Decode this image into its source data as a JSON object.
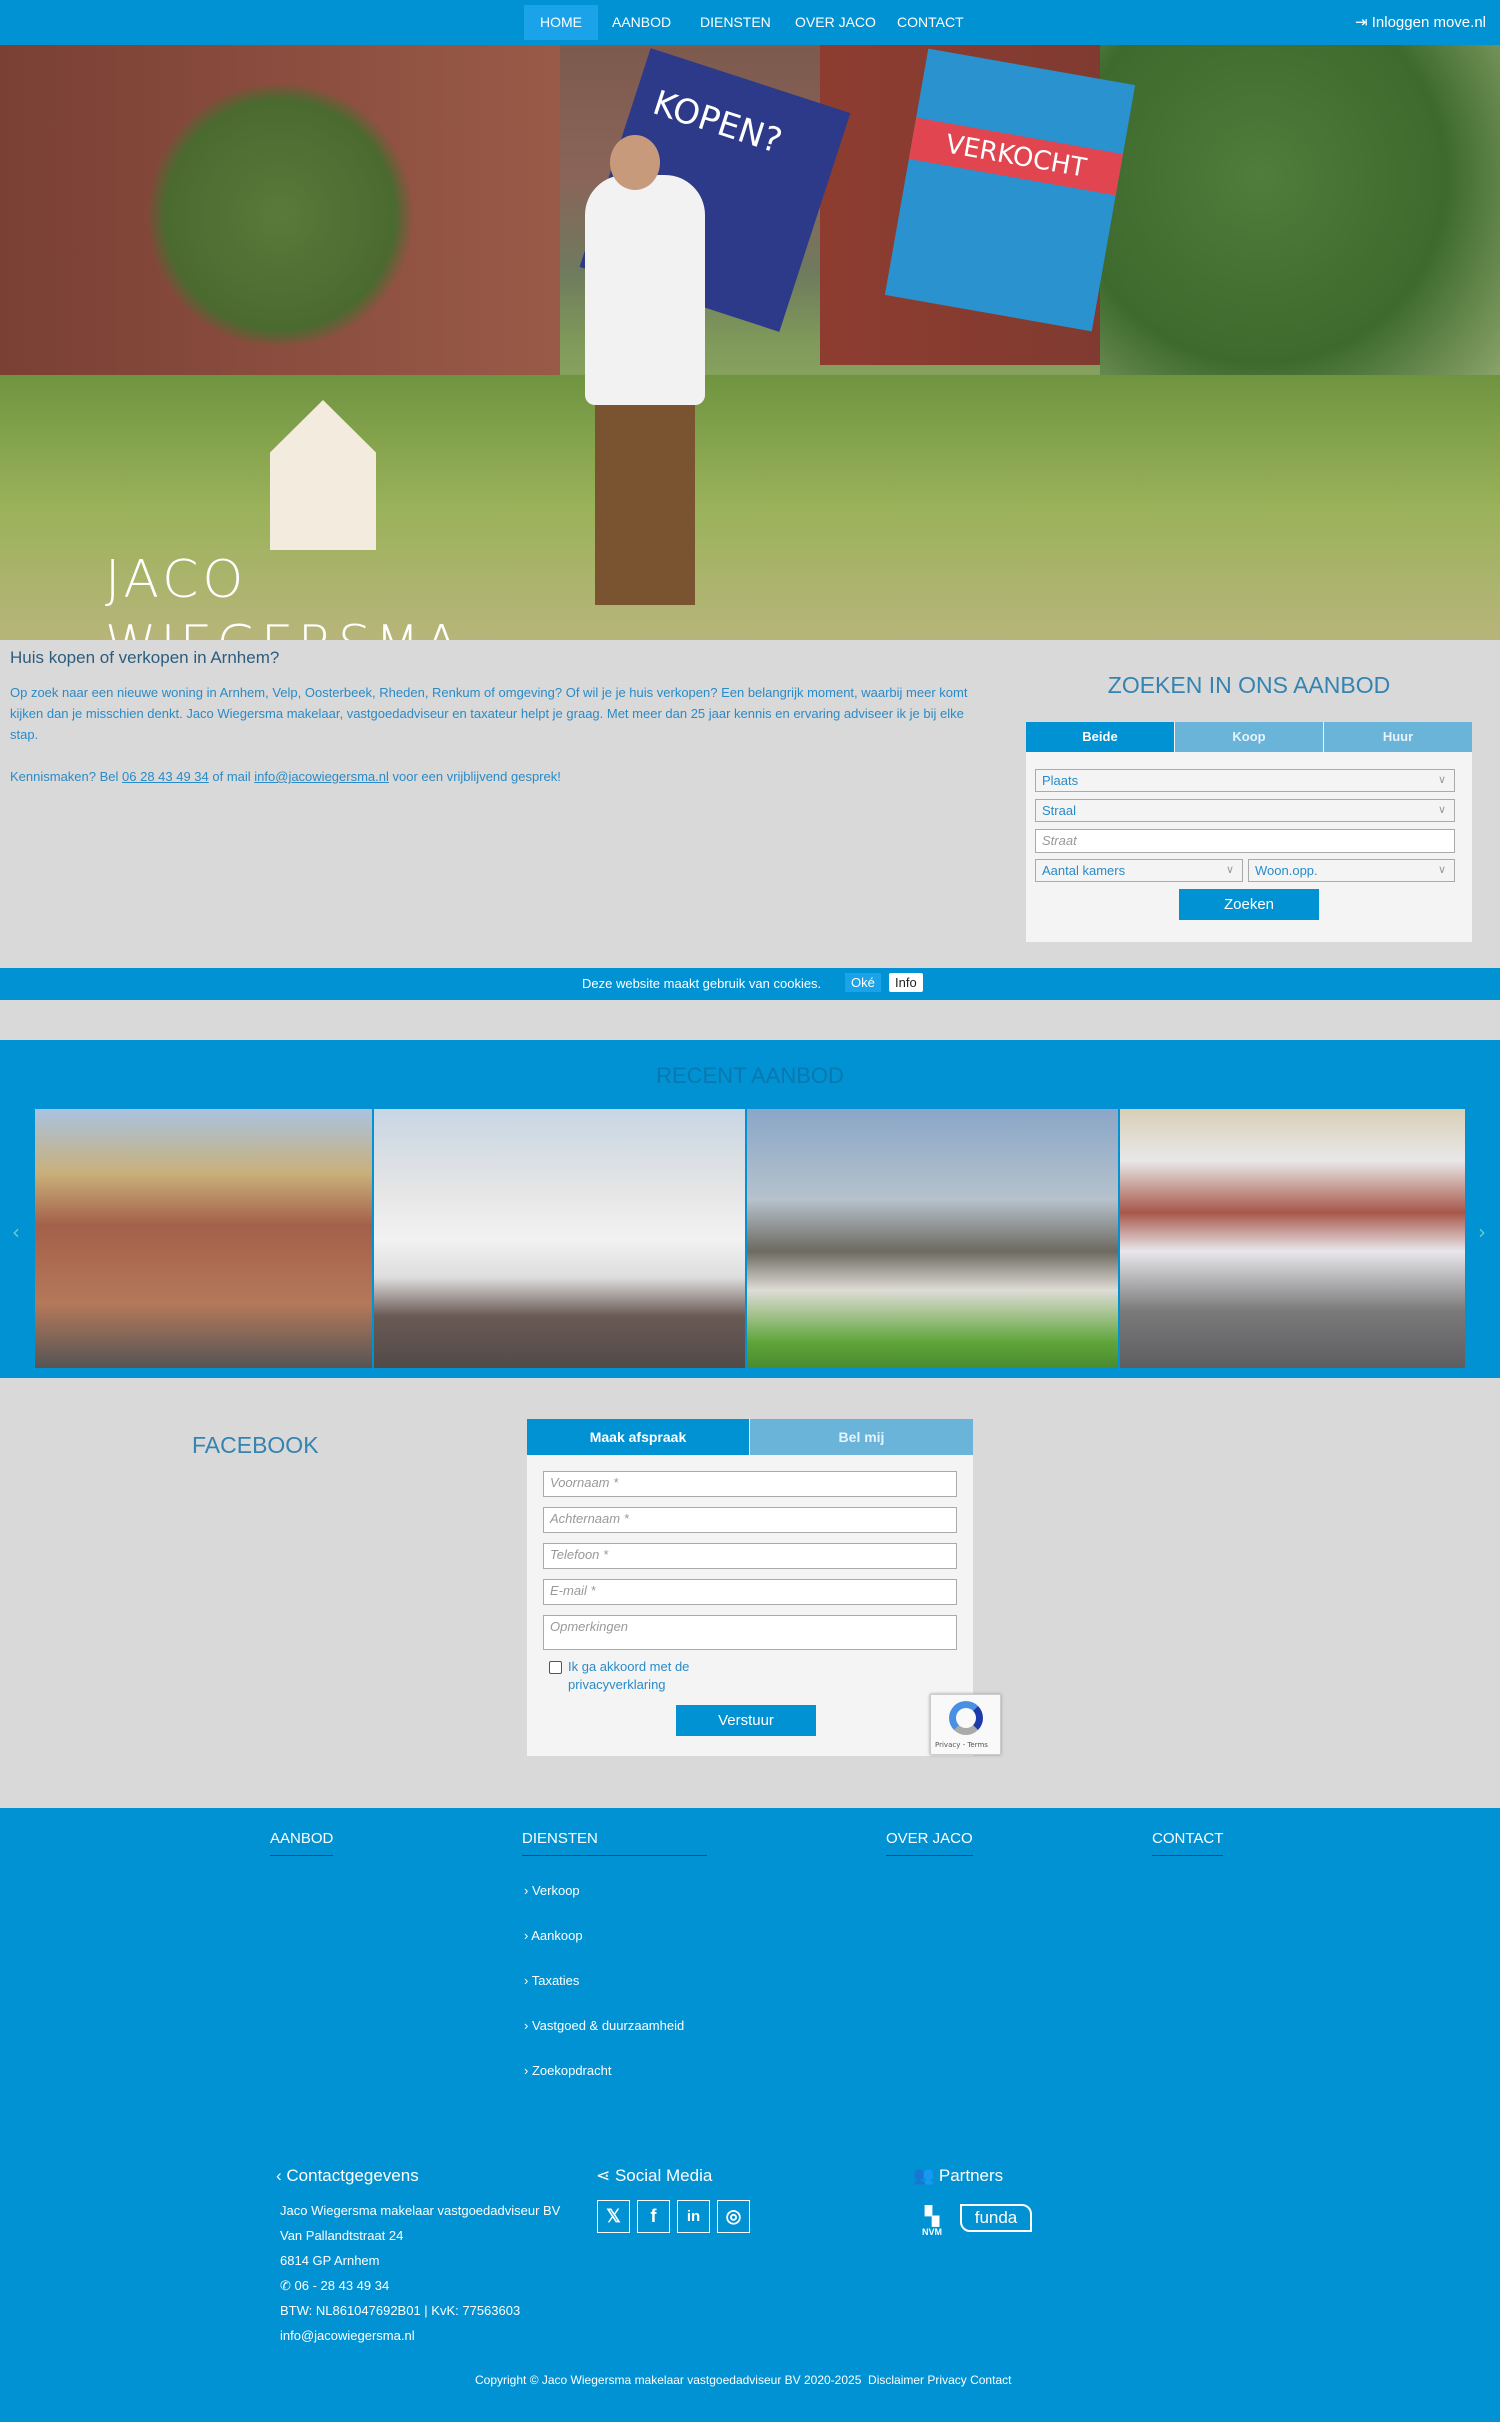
{
  "nav": {
    "items": [
      "HOME",
      "AANBOD",
      "DIENSTEN",
      "OVER JACO",
      "CONTACT"
    ],
    "active": "HOME",
    "login": "Inloggen move.nl"
  },
  "hero": {
    "logo_text": [
      "JACO",
      "WIEGERSMA"
    ],
    "sign_left": "KOPEN?",
    "sign_right": "VERKOCHT"
  },
  "intro": {
    "title": "Huis kopen of verkopen in Arnhem?",
    "paragraph": "Op zoek naar een nieuwe woning in Arnhem, Velp, Oosterbeek, Rheden, Renkum of omgeving? Of wil je je huis verkopen? Een belangrijk moment, waarbij meer komt kijken dan je misschien denkt. Jaco Wiegersma makelaar, vastgoedadviseur en taxateur helpt je graag. Met meer dan 25 jaar kennis en ervaring adviseer ik je bij elke stap.",
    "contact_prefix": "Kennismaken? Bel ",
    "phone": "06 28 43 49 34",
    "contact_mid": " of mail ",
    "email": "info@jacowiegersma.nl",
    "contact_suffix": " voor een vrijblijvend gesprek!"
  },
  "search": {
    "title": "ZOEKEN IN ONS AANBOD",
    "tabs": [
      "Beide",
      "Koop",
      "Huur"
    ],
    "active_tab": "Beide",
    "plaats": "Plaats",
    "straal": "Straal",
    "straat_placeholder": "Straat",
    "kamers": "Aantal kamers",
    "woonopp": "Woon.opp.",
    "submit": "Zoeken"
  },
  "cookie": {
    "text": "Deze website maakt gebruik van cookies.",
    "ok": "Oké",
    "info": "Info"
  },
  "recent": {
    "title": "RECENT AANBOD"
  },
  "facebook": {
    "title": "FACEBOOK"
  },
  "form": {
    "tabs": [
      "Maak afspraak",
      "Bel mij"
    ],
    "active_tab": "Maak afspraak",
    "voornaam": "Voornaam *",
    "achternaam": "Achternaam *",
    "telefoon": "Telefoon *",
    "email": "E-mail *",
    "opmerkingen": "Opmerkingen",
    "privacy": "Ik ga akkoord met de privacyverklaring",
    "submit": "Verstuur",
    "recaptcha": "Privacy - Terms"
  },
  "footer": {
    "headings": [
      "AANBOD",
      "DIENSTEN",
      "OVER JACO",
      "CONTACT"
    ],
    "diensten": [
      "Verkoop",
      "Aankoop",
      "Taxaties",
      "Vastgoed & duurzaamheid",
      "Zoekopdracht"
    ],
    "contact_title": "Contactgegevens",
    "company": "Jaco Wiegersma makelaar vastgoedadviseur BV",
    "street": "Van Pallandtstraat 24",
    "city": "6814 GP Arnhem",
    "phone": "06 - 28 43 49 34",
    "btw": "BTW: NL861047692B01 | KvK: 77563603",
    "email": "info@jacowiegersma.nl",
    "social_title": "Social Media",
    "social": [
      "x-icon",
      "facebook-icon",
      "linkedin-icon",
      "instagram-icon"
    ],
    "partners_title": "Partners",
    "partners": [
      "NVM",
      "funda"
    ],
    "copyright": "Copyright © Jaco Wiegersma makelaar vastgoedadviseur BV 2020-2025",
    "links": [
      "Disclaimer",
      "Privacy",
      "Contact"
    ]
  },
  "colors": {
    "brand": "#0092d2",
    "tab_inactive": "#6ab4d9",
    "background": "#d9d9d9"
  }
}
